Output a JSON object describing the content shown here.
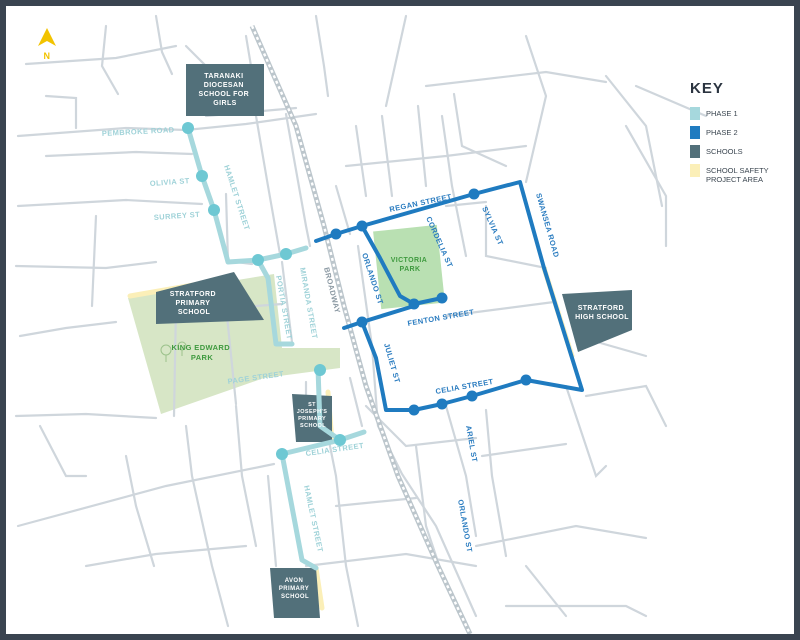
{
  "north_arrow": {
    "label": "N"
  },
  "key": {
    "title": "KEY",
    "items": [
      {
        "label": "PHASE 1",
        "color": "#a6d8dd"
      },
      {
        "label": "PHASE 2",
        "color": "#1f7bc0"
      },
      {
        "label": "SCHOOLS",
        "color": "#52707a"
      },
      {
        "label": "SCHOOL SAFETY PROJECT AREA",
        "color": "#fbefb8"
      }
    ]
  },
  "colors": {
    "roads": "#cfd6dc",
    "rail": "#bcc6cc",
    "park": "#d7e6c6",
    "victoria_park": "#b9e0b2",
    "school": "#52707a",
    "phase1": "#a6d8dd",
    "phase1_node": "#6ec8d3",
    "phase2": "#1f7bc0",
    "safety": "#fbefb8"
  },
  "streets": {
    "pembroke": "PEMBROKE ROAD",
    "olivia": "OLIVIA ST",
    "surrey": "SURREY ST",
    "hamlet_n": "HAMLET STREET",
    "miranda": "MIRANDA STREET",
    "portia": "PORTIA STREET",
    "broadway": "BROADWAY",
    "regan": "REGAN STREET",
    "orlando_n": "ORLANDO ST",
    "cordelia": "CORDELIA ST",
    "sylvia": "SYLVIA ST",
    "swansea": "SWANSEA ROAD",
    "fenton": "FENTON STREET",
    "juliet": "JULIET ST",
    "celia_e": "CELIA STREET",
    "ariel": "ARIEL ST",
    "orlando_s": "ORLANDO ST",
    "page": "PAGE STREET",
    "celia_w": "CELIA STREET",
    "hamlet_s": "HAMLET STREET"
  },
  "parks": {
    "victoria": [
      "VICTORIA",
      "PARK"
    ],
    "king_edward": [
      "KING EDWARD",
      "PARK"
    ]
  },
  "schools": {
    "taranaki": [
      "TARANAKI",
      "DIOCESAN",
      "SCHOOL FOR",
      "GIRLS"
    ],
    "stratford_primary": [
      "STRATFORD",
      "PRIMARY",
      "SCHOOL"
    ],
    "stratford_high": [
      "STRATFORD",
      "HIGH SCHOOL"
    ],
    "st_josephs": [
      "ST",
      "JOSEPH'S",
      "PRIMARY",
      "SCHOOL"
    ],
    "avon": [
      "AVON",
      "PRIMARY",
      "SCHOOL"
    ]
  }
}
